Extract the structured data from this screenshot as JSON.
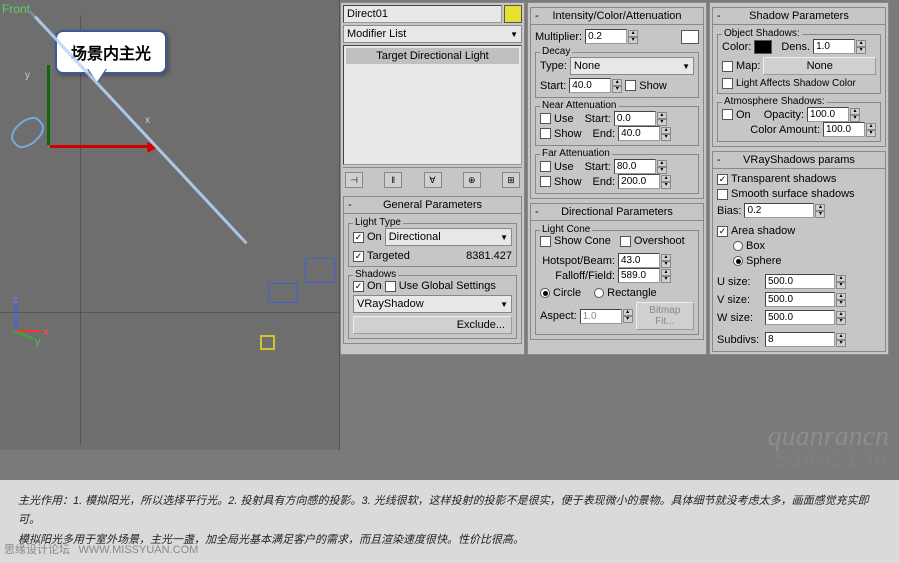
{
  "viewport": {
    "label": "Front",
    "callout": "场景内主光",
    "axis_x": "x",
    "axis_y": "y",
    "corner": {
      "x": "x",
      "y": "y",
      "z": "z"
    }
  },
  "modifier": {
    "object_name": "Direct01",
    "list_label": "Modifier List",
    "stack_item": "Target Directional Light",
    "buttons": {
      "pin": "⊣",
      "stack": "‖",
      "show": "∀",
      "result": "⊕",
      "config": "⊞"
    }
  },
  "general": {
    "title": "General Parameters",
    "light_type": {
      "group": "Light Type",
      "on": "On",
      "type": "Directional",
      "targeted": "Targeted",
      "dist": "8381.427"
    },
    "shadows": {
      "group": "Shadows",
      "on": "On",
      "global": "Use Global Settings",
      "type": "VRayShadow",
      "exclude": "Exclude..."
    }
  },
  "intensity": {
    "title": "Intensity/Color/Attenuation",
    "multiplier_label": "Multiplier:",
    "multiplier": "0.2",
    "decay": {
      "group": "Decay",
      "type_label": "Type:",
      "type": "None",
      "start_label": "Start:",
      "start": "40.0",
      "show": "Show"
    },
    "near": {
      "group": "Near Attenuation",
      "use": "Use",
      "start_label": "Start:",
      "start": "0.0",
      "show": "Show",
      "end_label": "End:",
      "end": "40.0"
    },
    "far": {
      "group": "Far Attenuation",
      "use": "Use",
      "start_label": "Start:",
      "start": "80.0",
      "show": "Show",
      "end_label": "End:",
      "end": "200.0"
    }
  },
  "directional": {
    "title": "Directional Parameters",
    "cone_group": "Light Cone",
    "show_cone": "Show Cone",
    "overshoot": "Overshoot",
    "hotspot_label": "Hotspot/Beam:",
    "hotspot": "43.0",
    "falloff_label": "Falloff/Field:",
    "falloff": "589.0",
    "circle": "Circle",
    "rectangle": "Rectangle",
    "aspect_label": "Aspect:",
    "aspect": "1.0",
    "bitmap": "Bitmap Fit..."
  },
  "shadow_params": {
    "title": "Shadow Parameters",
    "obj_group": "Object Shadows:",
    "color_label": "Color:",
    "dens_label": "Dens.",
    "dens": "1.0",
    "map": "Map:",
    "map_btn": "None",
    "affects": "Light Affects Shadow Color",
    "atmos_group": "Atmosphere Shadows:",
    "on": "On",
    "opacity_label": "Opacity:",
    "opacity": "100.0",
    "color_amt_label": "Color Amount:",
    "color_amt": "100.0"
  },
  "vray": {
    "title": "VRayShadows params",
    "transparent": "Transparent shadows",
    "smooth": "Smooth surface shadows",
    "bias_label": "Bias:",
    "bias": "0.2",
    "area": "Area shadow",
    "box": "Box",
    "sphere": "Sphere",
    "u_label": "U size:",
    "u": "500.0",
    "v_label": "V size:",
    "v": "500.0",
    "w_label": "W size:",
    "w": "500.0",
    "subdivs_label": "Subdivs:",
    "subdivs": "8"
  },
  "caption": {
    "line1": "主光作用：1. 模拟阳光，所以选择平行光。2. 投射具有方向感的投影。3. 光线很软，这样投射的投影不是很实，便于表现微小的景物。具体细节就没考虑太多，画面感觉充实即可。",
    "line2": "模拟阳光多用于室外场景，主光一盏，加全局光基本满足客户的需求，而且渲染速度很快。性价比很高。"
  },
  "watermark": {
    "text": "quanrancn",
    "num": "53492196"
  },
  "footer": {
    "site": "思缘设计论坛",
    "url": "WWW.MISSYUAN.COM"
  },
  "minus": "-",
  "check": "✓"
}
